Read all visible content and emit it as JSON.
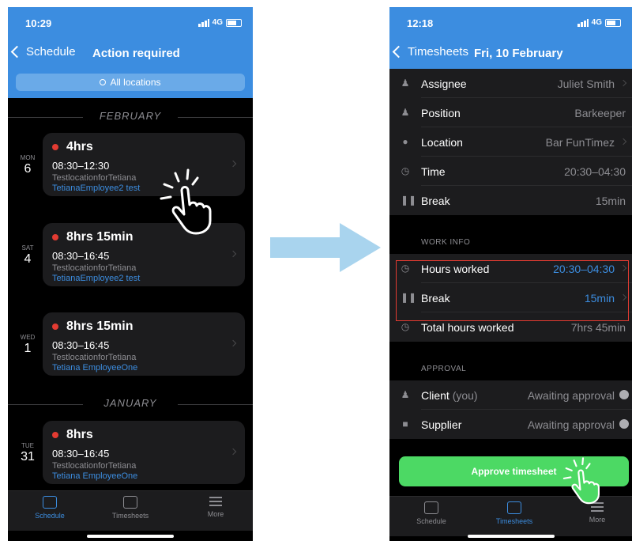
{
  "left": {
    "status_time": "10:29",
    "network": "4G",
    "back_label": "Schedule",
    "title": "Action required",
    "search_placeholder": "All locations",
    "months": [
      "FEBRUARY",
      "JANUARY"
    ],
    "shifts": [
      {
        "dow": "MON",
        "day": "6",
        "hours": "4hrs",
        "range": "08:30–12:30",
        "location": "TestlocationforTetiana",
        "employee": "TetianaEmployee2 test"
      },
      {
        "dow": "SAT",
        "day": "4",
        "hours": "8hrs 15min",
        "range": "08:30–16:45",
        "location": "TestlocationforTetiana",
        "employee": "TetianaEmployee2 test"
      },
      {
        "dow": "WED",
        "day": "1",
        "hours": "8hrs 15min",
        "range": "08:30–16:45",
        "location": "TestlocationforTetiana",
        "employee": "Tetiana EmployeeOne"
      },
      {
        "dow": "TUE",
        "day": "31",
        "hours": "8hrs",
        "range": "08:30–16:45",
        "location": "TestlocationforTetiana",
        "employee": "Tetiana EmployeeOne"
      }
    ],
    "tabs": [
      "Schedule",
      "Timesheets",
      "More"
    ]
  },
  "right": {
    "status_time": "12:18",
    "network": "4G",
    "back_label": "Timesheets",
    "title": "Fri, 10 February",
    "rows": [
      {
        "label": "Assignee",
        "value": "Juliet Smith"
      },
      {
        "label": "Position",
        "value": "Barkeeper"
      },
      {
        "label": "Location",
        "value": "Bar FunTimez"
      },
      {
        "label": "Time",
        "value": "20:30–04:30"
      },
      {
        "label": "Break",
        "value": "15min"
      }
    ],
    "work_info_header": "WORK INFO",
    "work_rows": [
      {
        "label": "Hours worked",
        "value": "20:30–04:30"
      },
      {
        "label": "Break",
        "value": "15min"
      },
      {
        "label": "Total hours worked",
        "value": "7hrs 45min"
      }
    ],
    "approval_header": "APPROVAL",
    "approval_rows": [
      {
        "label": "Client",
        "label_suffix": "(you)",
        "value": "Awaiting approval"
      },
      {
        "label": "Supplier",
        "value": "Awaiting approval"
      }
    ],
    "approve_button": "Approve timesheet",
    "tabs": [
      "Schedule",
      "Timesheets",
      "More"
    ]
  },
  "colors": {
    "accent": "#3c8de0",
    "danger": "#e33b32",
    "success": "#4cd964",
    "card": "#1c1c1e"
  }
}
